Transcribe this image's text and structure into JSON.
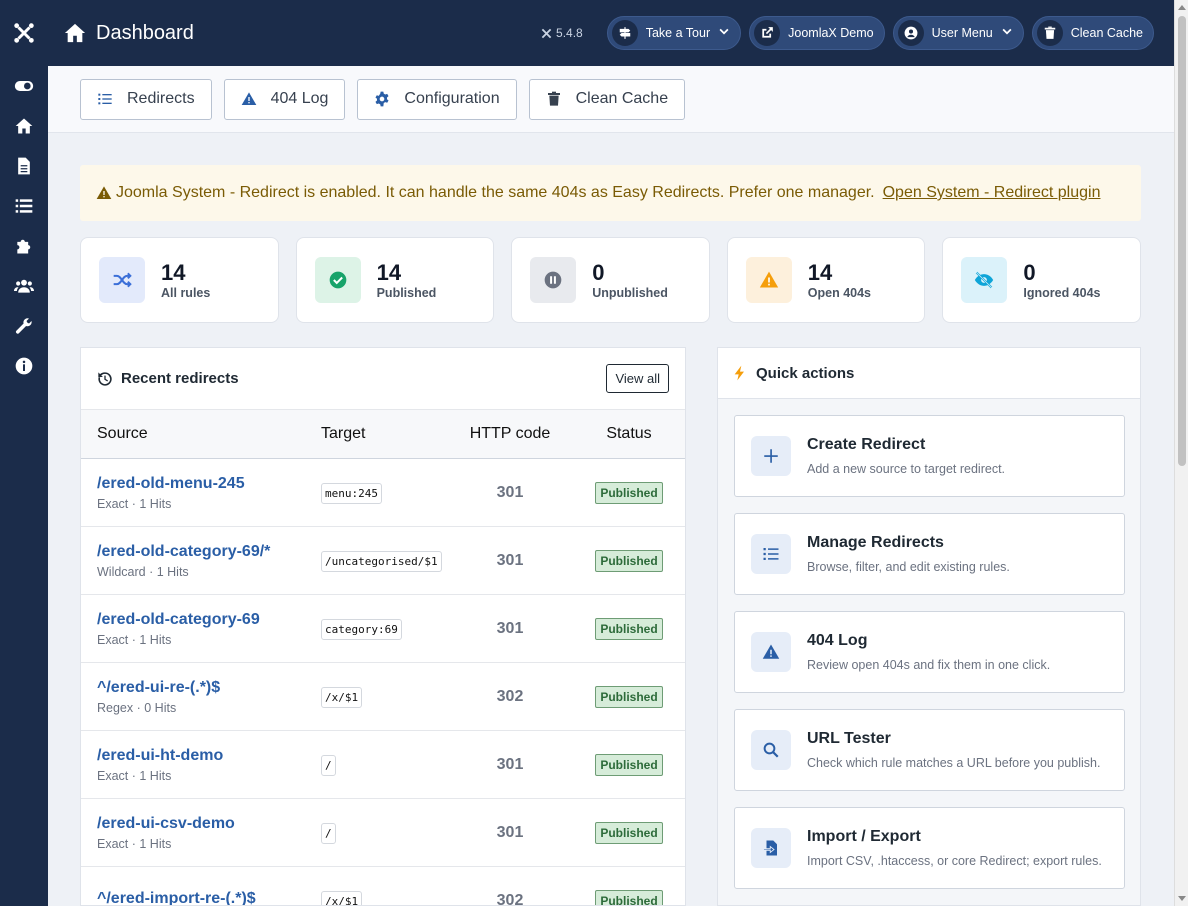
{
  "header": {
    "title": "Dashboard",
    "version": "5.4.8",
    "buttons": [
      {
        "label": "Take a Tour"
      },
      {
        "label": "JoomlaX Demo"
      },
      {
        "label": "User Menu"
      },
      {
        "label": "Clean Cache"
      }
    ]
  },
  "sidebar": {
    "items": [
      "toggle-icon",
      "home-icon",
      "file-icon",
      "list-icon",
      "puzzle-icon",
      "users-icon",
      "wrench-icon",
      "info-icon"
    ]
  },
  "toolbar": {
    "items": [
      {
        "label": "Redirects",
        "icon": "list-icon"
      },
      {
        "label": "404 Log",
        "icon": "warning-icon"
      },
      {
        "label": "Configuration",
        "icon": "gear-icon"
      },
      {
        "label": "Clean Cache",
        "icon": "trash-icon"
      }
    ]
  },
  "alert": {
    "text": "Joomla System - Redirect is enabled. It can handle the same 404s as Easy Redirects. Prefer one manager.",
    "link": "Open System - Redirect plugin"
  },
  "stats": [
    {
      "value": "14",
      "label": "All rules",
      "color": "#3b6fd8"
    },
    {
      "value": "14",
      "label": "Published",
      "color": "#17a36a"
    },
    {
      "value": "0",
      "label": "Unpublished",
      "color": "#6b7280"
    },
    {
      "value": "14",
      "label": "Open 404s",
      "color": "#f59e0b"
    },
    {
      "value": "0",
      "label": "Ignored 404s",
      "color": "#0ea5d8"
    }
  ],
  "recent": {
    "title": "Recent redirects",
    "view_all": "View all",
    "columns": {
      "source": "Source",
      "target": "Target",
      "code": "HTTP code",
      "status": "Status"
    },
    "rows": [
      {
        "source": "/ered-old-menu-245",
        "meta": "Exact · 1 Hits",
        "target": "menu:245",
        "code": "301",
        "status": "Published"
      },
      {
        "source": "/ered-old-category-69/*",
        "meta": "Wildcard · 1 Hits",
        "target": "/uncategorised/$1",
        "code": "301",
        "status": "Published"
      },
      {
        "source": "/ered-old-category-69",
        "meta": "Exact · 1 Hits",
        "target": "category:69",
        "code": "301",
        "status": "Published"
      },
      {
        "source": "^/ered-ui-re-(.*)$",
        "meta": "Regex · 0 Hits",
        "target": "/x/$1",
        "code": "302",
        "status": "Published"
      },
      {
        "source": "/ered-ui-ht-demo",
        "meta": "Exact · 1 Hits",
        "target": "/",
        "code": "301",
        "status": "Published"
      },
      {
        "source": "/ered-ui-csv-demo",
        "meta": "Exact · 1 Hits",
        "target": "/",
        "code": "301",
        "status": "Published"
      },
      {
        "source": "^/ered-import-re-(.*)$",
        "meta": "",
        "target": "/x/$1",
        "code": "302",
        "status": "Published"
      }
    ]
  },
  "quick": {
    "title": "Quick actions",
    "items": [
      {
        "title": "Create Redirect",
        "desc": "Add a new source to target redirect.",
        "icon": "plus-icon"
      },
      {
        "title": "Manage Redirects",
        "desc": "Browse, filter, and edit existing rules.",
        "icon": "list-icon"
      },
      {
        "title": "404 Log",
        "desc": "Review open 404s and fix them in one click.",
        "icon": "warning-icon"
      },
      {
        "title": "URL Tester",
        "desc": "Check which rule matches a URL before you publish.",
        "icon": "search-icon"
      },
      {
        "title": "Import / Export",
        "desc": "Import CSV, .htaccess, or core Redirect; export rules.",
        "icon": "import-icon"
      }
    ]
  }
}
